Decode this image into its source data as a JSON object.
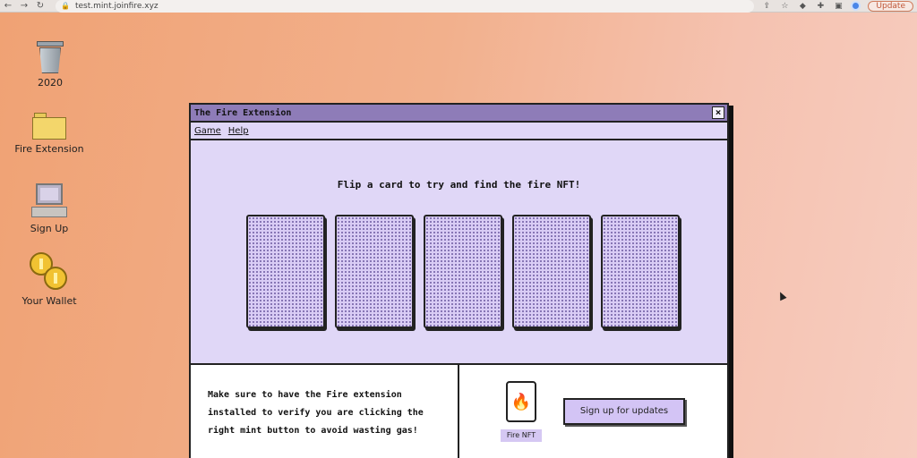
{
  "browser": {
    "url": "test.mint.joinfire.xyz",
    "update_label": "Update"
  },
  "desktop": {
    "icons": [
      {
        "label": "2020",
        "icon": "trash-icon"
      },
      {
        "label": "Fire Extension",
        "icon": "folder-icon"
      },
      {
        "label": "Sign Up",
        "icon": "computer-icon"
      },
      {
        "label": "Your Wallet",
        "icon": "coins-icon"
      }
    ]
  },
  "window": {
    "title": "The Fire Extension",
    "close_label": "×",
    "menu": [
      "Game",
      "Help"
    ],
    "prompt": "Flip a card to try and find the fire NFT!",
    "card_count": 5,
    "info_text": "Make sure to have the Fire extension installed to verify you are clicking the right mint button to avoid wasting gas!",
    "nft_icon": "🔥",
    "nft_label": "Fire NFT",
    "signup_label": "Sign up for updates"
  },
  "colors": {
    "titlebar": "#8e7cb8",
    "window_bg": "#e0d7f7",
    "card_bg": "#d9ccf5",
    "button_bg": "#d3c4f5"
  }
}
